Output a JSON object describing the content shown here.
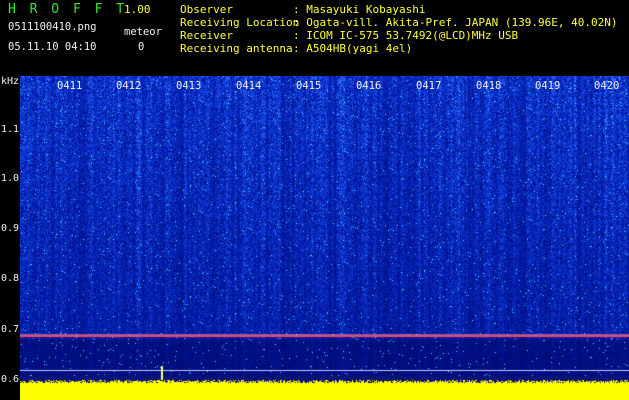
{
  "header": {
    "app_title": "H R O F F T",
    "version": "1.00",
    "filename": "0511100410.png",
    "datetime": "05.11.10 04:10",
    "meteor_label": "meteor",
    "meteor_count": "0"
  },
  "info": [
    {
      "label": "Observer",
      "value": ": Masayuki Kobayashi"
    },
    {
      "label": "Receiving Location",
      "value": ": Ogata-vill. Akita-Pref. JAPAN (139.96E, 40.02N)"
    },
    {
      "label": "Receiver",
      "value": ": ICOM IC-575 53.7492(@LCD)MHz USB"
    },
    {
      "label": "Receiving antenna",
      "value": ": A504HB(yagi 4el)"
    }
  ],
  "y_axis": {
    "unit": "kHz",
    "ticks": [
      "1.1",
      "1.0",
      "0.9",
      "0.8",
      "0.7",
      "0.6"
    ]
  },
  "time_labels": [
    "0411",
    "0412",
    "0413",
    "0414",
    "0415",
    "0416",
    "0417",
    "0418",
    "0419",
    "0420"
  ],
  "colors": {
    "title_green": "#2ee82e",
    "version_yellow": "#ffff3a",
    "signal_line": "#ff4040",
    "noise_floor": "#ffff00",
    "background_blue": "#0a1a8c"
  }
}
